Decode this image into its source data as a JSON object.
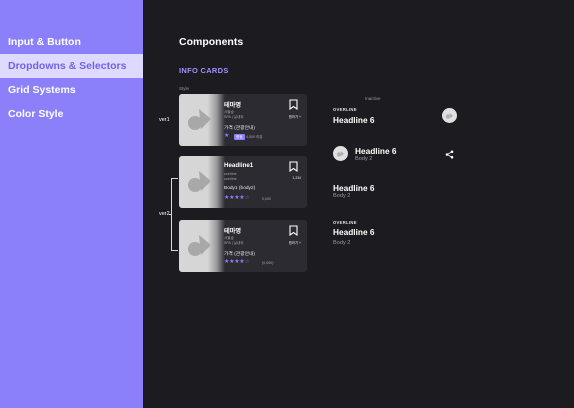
{
  "sidebar": {
    "items": [
      {
        "label": "Input & Button",
        "active": false
      },
      {
        "label": "Dropdowns & Selectors",
        "active": true
      },
      {
        "label": "Grid Systems",
        "active": false
      },
      {
        "label": "Color Style",
        "active": false
      }
    ]
  },
  "main": {
    "title": "Components",
    "section": "INFO CARDS",
    "style_label": "Style",
    "ver1_label": "ver1",
    "ver2_label": "ver2",
    "inactive_label": "Inactive"
  },
  "cards": [
    {
      "title": "테마명",
      "sub1": "서울숲",
      "sub2": "SPA | 실내외",
      "body": "가격 (관광안내)",
      "badge": "평점",
      "rating_text": "4,500 리뷰",
      "rating": 1,
      "bookmark_label": "찜하기 +"
    },
    {
      "title": "Headline1",
      "sub1": "overline",
      "sub2": "overline",
      "body": "Body1 (body2)",
      "rating_text": "0,000",
      "rating": 3.5,
      "bookmark_label": "1,234"
    },
    {
      "title": "테마명",
      "sub1": "서울숲",
      "sub2": "SPA | 실내외",
      "body": "가격 (관광안내)",
      "rating_text": "(0,000)",
      "rating": 4,
      "bookmark_label": "찜하기 +"
    }
  ],
  "list_items": [
    {
      "overline": "OVERLINE",
      "headline": "Headline 6"
    },
    {
      "headline": "Headline 6",
      "body": "Body 2"
    },
    {
      "headline": "Headline 6",
      "body": "Body 2"
    },
    {
      "overline": "OVERLINE",
      "headline": "Headline 6",
      "body": "Body 2"
    }
  ],
  "colors": {
    "accent": "#8b80f9",
    "sidebar_bg": "#8b80f9",
    "active_item_bg": "#ddd9ff",
    "canvas_bg": "#1c1b20",
    "card_bg": "#2c2b31"
  }
}
